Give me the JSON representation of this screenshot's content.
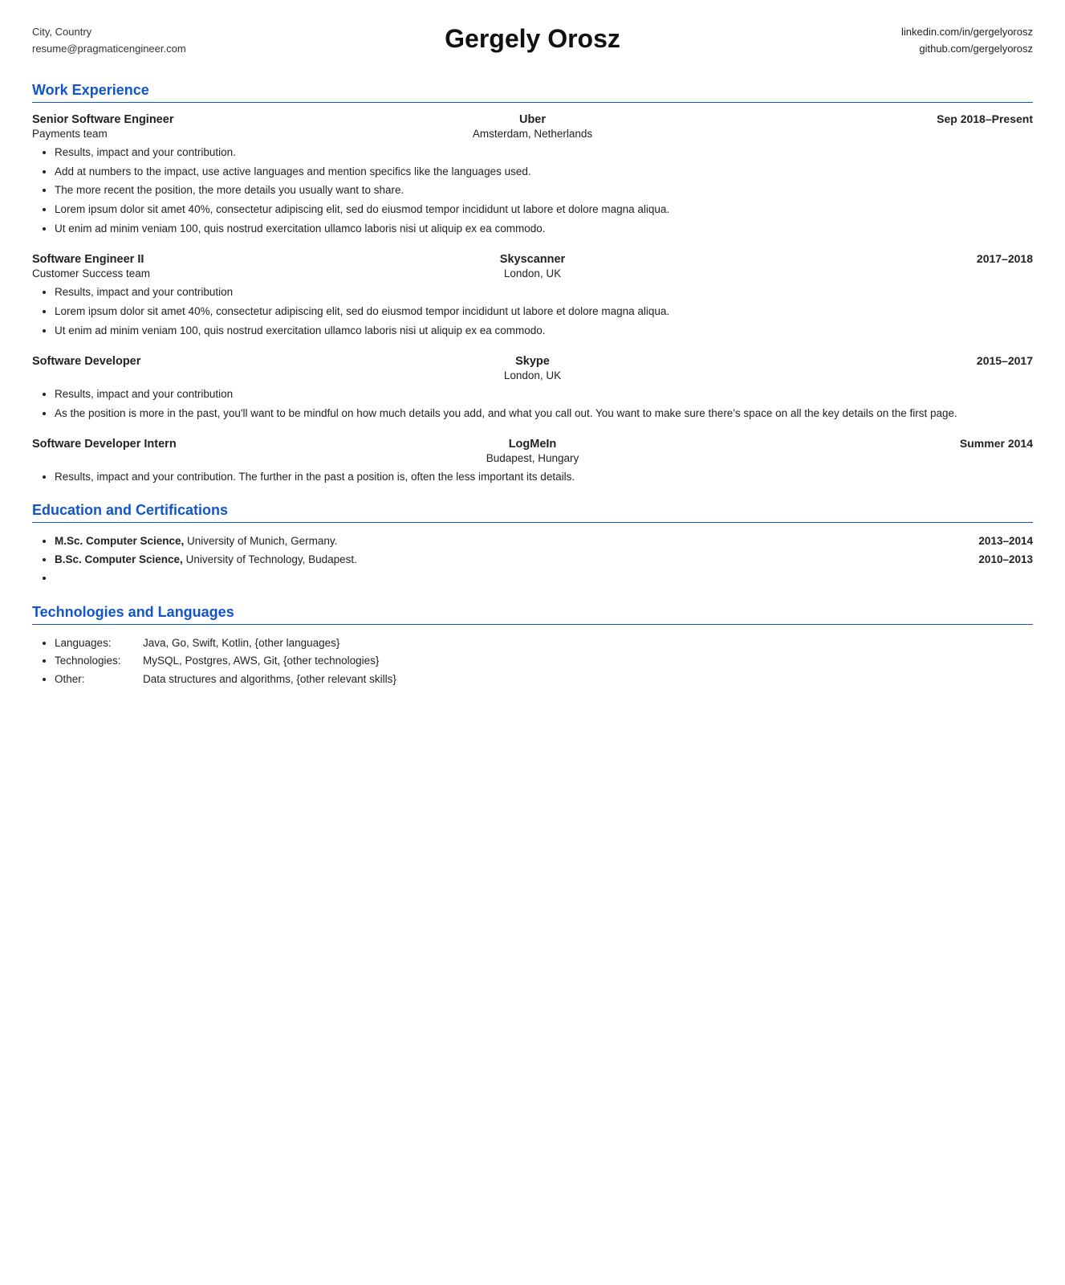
{
  "header": {
    "left_line1": "City, Country",
    "left_line2": "resume@pragmaticengineer.com",
    "name": "Gergely Orosz",
    "linkedin": "linkedin.com/in/gergelyorosz",
    "github": "github.com/gergelyorosz"
  },
  "sections": {
    "work_experience": {
      "title": "Work Experience",
      "jobs": [
        {
          "title": "Senior Software Engineer",
          "company": "Uber",
          "date": "Sep 2018–Present",
          "team": "Payments team",
          "location": "Amsterdam, Netherlands",
          "bullets": [
            "Results, impact and your contribution.",
            "Add at numbers to the impact, use active languages and mention specifics like the languages used.",
            "The more recent the position, the more details you usually want to share.",
            "Lorem ipsum dolor sit amet 40%, consectetur adipiscing elit, sed do eiusmod tempor incididunt ut labore et dolore magna aliqua.",
            "Ut enim ad minim veniam 100, quis nostrud exercitation ullamco laboris nisi ut aliquip ex ea commodo."
          ]
        },
        {
          "title": "Software Engineer II",
          "company": "Skyscanner",
          "date": "2017–2018",
          "team": "Customer Success team",
          "location": "London, UK",
          "bullets": [
            "Results, impact and your contribution",
            "Lorem ipsum dolor sit amet 40%, consectetur adipiscing elit, sed do eiusmod tempor incididunt ut labore et dolore magna aliqua.",
            "Ut enim ad minim veniam 100, quis nostrud exercitation ullamco laboris nisi ut aliquip ex ea commodo."
          ]
        },
        {
          "title": "Software Developer",
          "company": "Skype",
          "date": "2015–2017",
          "team": "",
          "location": "London, UK",
          "bullets": [
            "Results, impact and your contribution",
            "As the position is more in the past, you'll want to be mindful on how much details you add, and what you call out. You want to make sure there's space on all the key details on the first page."
          ]
        },
        {
          "title": "Software Developer Intern",
          "company": "LogMeIn",
          "date": "Summer 2014",
          "team": "",
          "location": "Budapest, Hungary",
          "bullets": [
            "Results, impact and your contribution. The further in the past a position is, often the less important its details."
          ]
        }
      ]
    },
    "education": {
      "title": "Education and Certifications",
      "items": [
        {
          "degree_bold": "M.Sc. Computer Science,",
          "degree_rest": " University of Munich, Germany.",
          "year": "2013–2014"
        },
        {
          "degree_bold": "B.Sc. Computer Science,",
          "degree_rest": " University of Technology, Budapest.",
          "year": "2010–2013"
        },
        {
          "degree_bold": "",
          "degree_rest": "",
          "year": ""
        }
      ]
    },
    "technologies": {
      "title": "Technologies and Languages",
      "items": [
        {
          "label": "Languages:",
          "value": "Java, Go, Swift, Kotlin, {other languages}"
        },
        {
          "label": "Technologies:",
          "value": "MySQL, Postgres, AWS, Git, {other technologies}"
        },
        {
          "label": "Other:",
          "value": "Data structures and algorithms, {other relevant skills}"
        }
      ]
    }
  }
}
